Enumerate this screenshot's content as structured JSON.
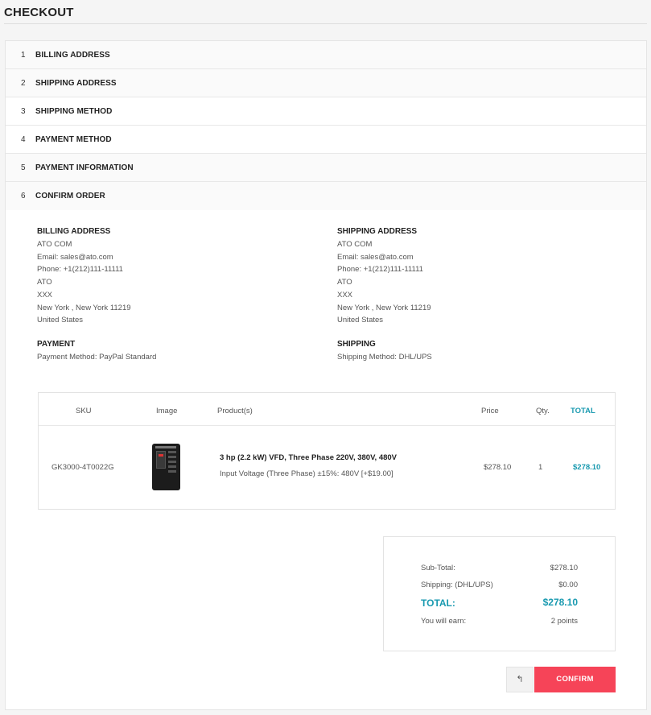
{
  "page": {
    "title": "CHECKOUT"
  },
  "steps": [
    {
      "num": "1",
      "label": "BILLING ADDRESS"
    },
    {
      "num": "2",
      "label": "SHIPPING ADDRESS"
    },
    {
      "num": "3",
      "label": "SHIPPING METHOD"
    },
    {
      "num": "4",
      "label": "PAYMENT METHOD"
    },
    {
      "num": "5",
      "label": "PAYMENT INFORMATION"
    },
    {
      "num": "6",
      "label": "CONFIRM ORDER"
    }
  ],
  "billing": {
    "heading": "BILLING ADDRESS",
    "lines": [
      "ATO COM",
      "Email: sales@ato.com",
      "Phone: +1(212)111-11111",
      "ATO",
      "XXX",
      "New York , New York 11219",
      "United States"
    ]
  },
  "shipping": {
    "heading": "SHIPPING ADDRESS",
    "lines": [
      "ATO COM",
      "Email: sales@ato.com",
      "Phone: +1(212)111-11111",
      "ATO",
      "XXX",
      "New York , New York 11219",
      "United States"
    ]
  },
  "payment": {
    "heading": "PAYMENT",
    "method": "Payment Method: PayPal Standard"
  },
  "shipping_method": {
    "heading": "SHIPPING",
    "method": "Shipping Method: DHL/UPS"
  },
  "table": {
    "headers": {
      "sku": "SKU",
      "image": "Image",
      "products": "Product(s)",
      "price": "Price",
      "qty": "Qty.",
      "total": "TOTAL"
    },
    "row": {
      "sku": "GK3000-4T0022G",
      "name": "3 hp (2.2 kW) VFD, Three Phase 220V, 380V, 480V",
      "option": "Input Voltage (Three Phase) ±15%: 480V [+$19.00]",
      "price": "$278.10",
      "qty": "1",
      "total": "$278.10",
      "image_icon": "vfd-drive-product-image"
    }
  },
  "summary": {
    "subtotal_label": "Sub-Total:",
    "subtotal_value": "$278.10",
    "shipping_label": "Shipping: (DHL/UPS)",
    "shipping_value": "$0.00",
    "total_label": "TOTAL:",
    "total_value": "$278.10",
    "earn_label": "You will earn:",
    "earn_value": "2 points"
  },
  "actions": {
    "back_icon": "↰",
    "confirm_label": "CONFIRM"
  },
  "colors": {
    "accent": "#1a9ab0",
    "confirm": "#f64458"
  }
}
